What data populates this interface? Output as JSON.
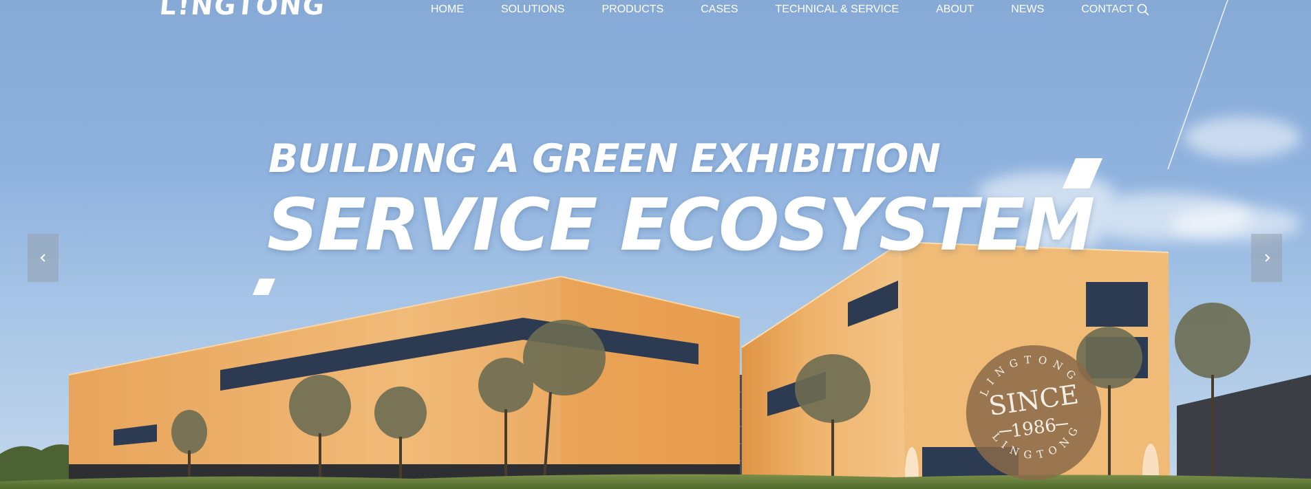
{
  "header": {
    "logo_text": "L!NGTONG",
    "nav": [
      {
        "label": "HOME"
      },
      {
        "label": "SOLUTIONS"
      },
      {
        "label": "PRODUCTS"
      },
      {
        "label": "CASES"
      },
      {
        "label": "TECHNICAL & SERVICE"
      },
      {
        "label": "ABOUT"
      },
      {
        "label": "NEWS"
      },
      {
        "label": "CONTACT"
      }
    ],
    "search_icon": "search-icon"
  },
  "hero": {
    "headline_line1": "BUILDING A GREEN EXHIBITION",
    "headline_line2": "SERVICE  ECOSYSTEM",
    "prev_icon": "chevron-left-icon",
    "next_icon": "chevron-right-icon",
    "seal": {
      "ring_text": "LINGTONG",
      "since": "SINCE",
      "year": "1986"
    }
  },
  "colors": {
    "sky_top": "#86a9d6",
    "building_orange": "#e9a556",
    "building_light": "#f0bd77",
    "seal_brown": "#8a6a4a",
    "text_white": "#ffffff"
  }
}
